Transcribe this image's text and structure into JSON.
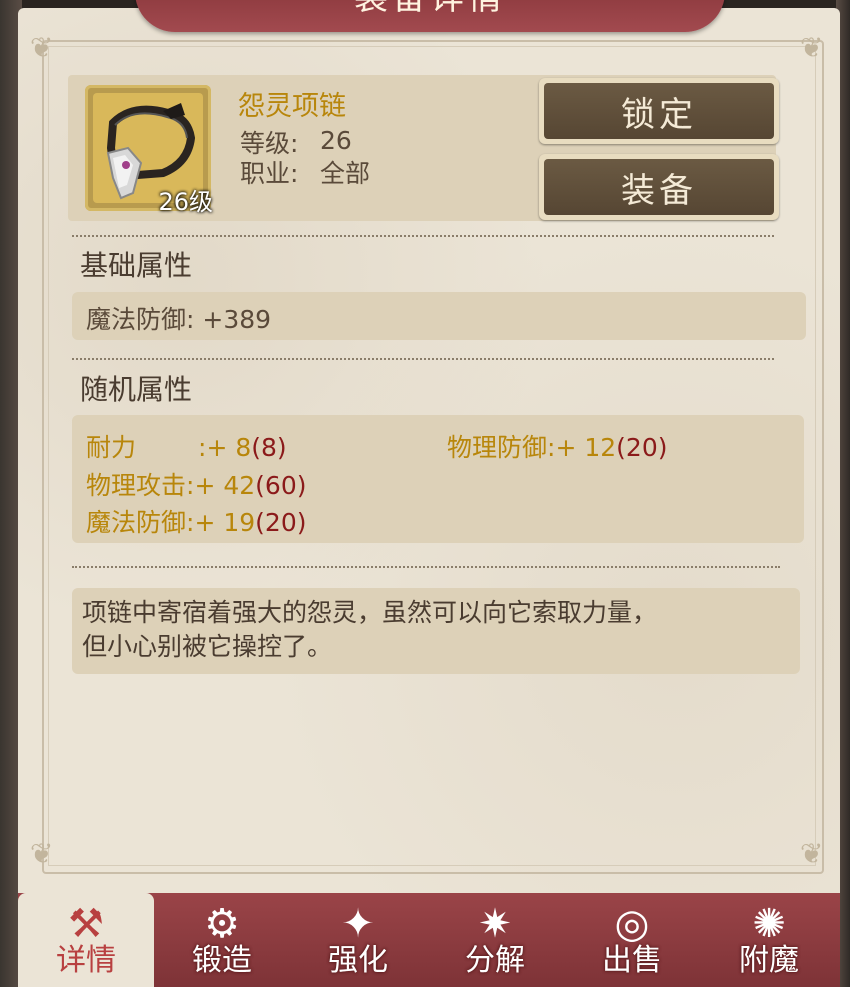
{
  "title": "装备详情",
  "item": {
    "name": "怨灵项链",
    "icon_level": "26级",
    "level_label": "等级:",
    "level_value": "26",
    "class_label": "职业:",
    "class_value": "全部"
  },
  "buttons": {
    "lock": "锁定",
    "equip": "装备"
  },
  "base_attributes": {
    "title": "基础属性",
    "stat": "魔法防御: +389"
  },
  "random_attributes": {
    "title": "随机属性",
    "rows": [
      {
        "label": "耐力",
        "sep": ":+ ",
        "value": "8",
        "max": "(8)"
      },
      {
        "label": "物理防御",
        "sep": ":+ ",
        "value": "12",
        "max": "(20)"
      },
      {
        "label": "物理攻击",
        "sep": ":+ ",
        "value": "42",
        "max": "(60)"
      },
      {
        "label": "魔法防御",
        "sep": ":+ ",
        "value": "19",
        "max": "(20)"
      }
    ]
  },
  "description": {
    "line1": "项链中寄宿着强大的怨灵，虽然可以向它索取力量，",
    "line2": "但小心别被它操控了。"
  },
  "tabs": [
    {
      "label": "详情",
      "icon": "hammer-cross-icon",
      "glyph": "⚒",
      "active": true
    },
    {
      "label": "锻造",
      "icon": "anvil-icon",
      "glyph": "⚙",
      "active": false
    },
    {
      "label": "强化",
      "icon": "sparkle-wand-icon",
      "glyph": "✦",
      "active": false
    },
    {
      "label": "分解",
      "icon": "burst-icon",
      "glyph": "✷",
      "active": false
    },
    {
      "label": "出售",
      "icon": "coins-icon",
      "glyph": "◎",
      "active": false
    },
    {
      "label": "附魔",
      "icon": "swirl-icon",
      "glyph": "✺",
      "active": false
    }
  ],
  "colors": {
    "accent": "#9a4448",
    "gold": "#b8860b",
    "red": "#8b1a1a"
  }
}
